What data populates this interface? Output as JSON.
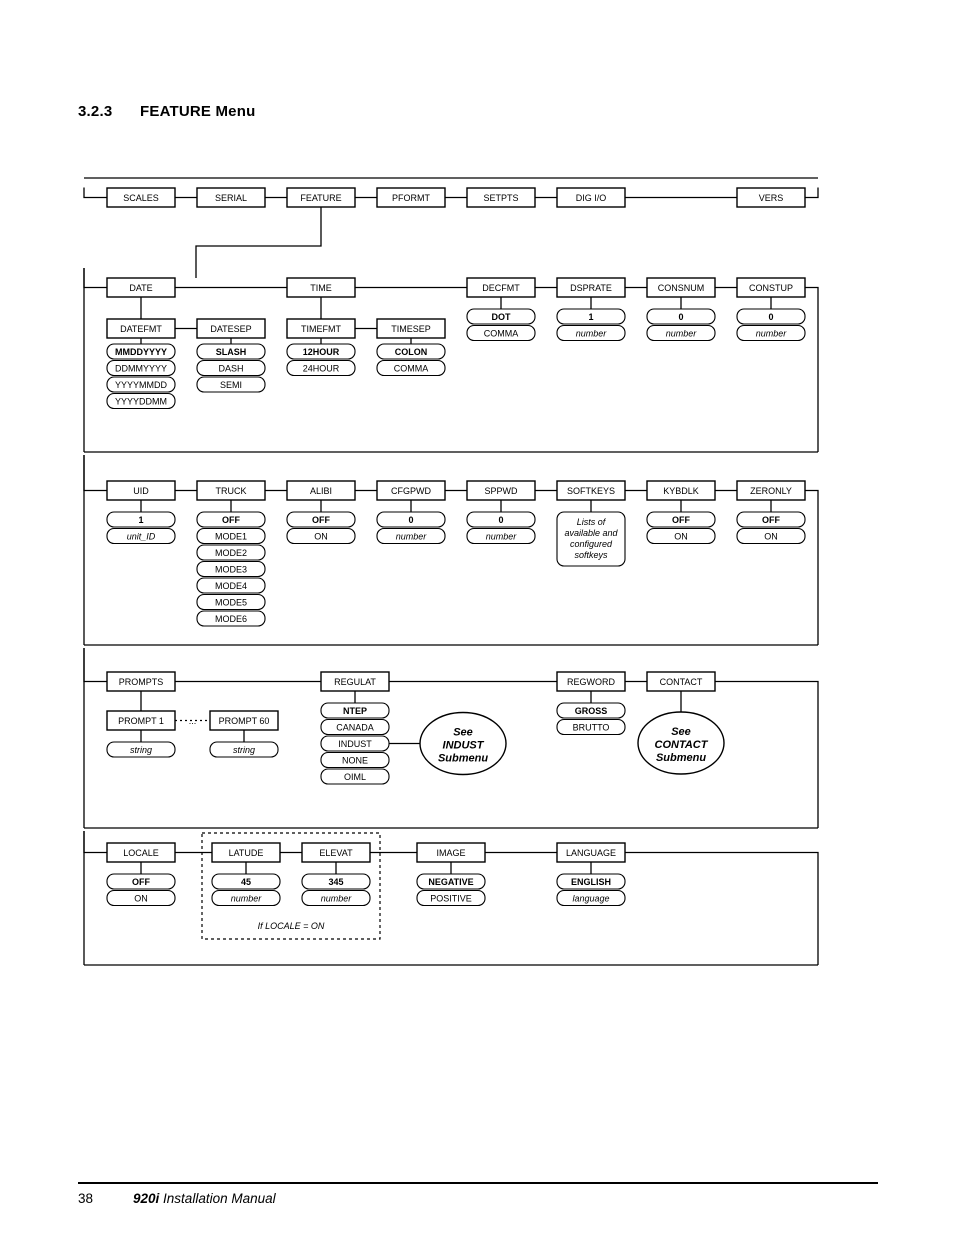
{
  "heading": {
    "number": "3.2.3",
    "title": "FEATURE Menu"
  },
  "footer": {
    "page_number": "38",
    "model": "920i",
    "title": "Installation Manual"
  },
  "top_menu": {
    "items": [
      {
        "label": "SCALES"
      },
      {
        "label": "SERIAL"
      },
      {
        "label": "FEATURE"
      },
      {
        "label": "PFORMT"
      },
      {
        "label": "SETPTS"
      },
      {
        "label": "DIG I/O"
      },
      {
        "label": "VERS"
      }
    ],
    "expanded": "FEATURE"
  },
  "rows": [
    {
      "id": "row-1",
      "nodes": [
        {
          "label": "DATE",
          "children": [
            {
              "label": "DATEFMT",
              "values": [
                "MMDDYYYY",
                "DDMMYYYY",
                "YYYYMMDD",
                "YYYYDDMM"
              ],
              "default": "MMDDYYYY"
            },
            {
              "label": "DATESEP",
              "values": [
                "SLASH",
                "DASH",
                "SEMI"
              ],
              "default": "SLASH"
            }
          ]
        },
        {
          "label": "TIME",
          "children": [
            {
              "label": "TIMEFMT",
              "values": [
                "12HOUR",
                "24HOUR"
              ],
              "default": "12HOUR"
            },
            {
              "label": "TIMESEP",
              "values": [
                "COLON",
                "COMMA"
              ],
              "default": "COLON"
            }
          ]
        },
        {
          "label": "DECFMT",
          "values": [
            "DOT",
            "COMMA"
          ],
          "default": "DOT"
        },
        {
          "label": "DSPRATE",
          "values": [
            "1",
            "number"
          ],
          "default": "1",
          "italic": [
            "number"
          ]
        },
        {
          "label": "CONSNUM",
          "values": [
            "0",
            "number"
          ],
          "default": "0",
          "italic": [
            "number"
          ]
        },
        {
          "label": "CONSTUP",
          "values": [
            "0",
            "number"
          ],
          "default": "0",
          "italic": [
            "number"
          ]
        }
      ]
    },
    {
      "id": "row-2",
      "nodes": [
        {
          "label": "UID",
          "values": [
            "1",
            "unit_ID"
          ],
          "default": "1",
          "italic": [
            "unit_ID"
          ]
        },
        {
          "label": "TRUCK",
          "values": [
            "OFF",
            "MODE1",
            "MODE2",
            "MODE3",
            "MODE4",
            "MODE5",
            "MODE6"
          ],
          "default": "OFF"
        },
        {
          "label": "ALIBI",
          "values": [
            "OFF",
            "ON"
          ],
          "default": "OFF"
        },
        {
          "label": "CFGPWD",
          "values": [
            "0",
            "number"
          ],
          "default": "0",
          "italic": [
            "number"
          ]
        },
        {
          "label": "SPPWD",
          "values": [
            "0",
            "number"
          ],
          "default": "0",
          "italic": [
            "number"
          ]
        },
        {
          "label": "SOFTKEYS",
          "multiline_value": [
            "Lists of",
            "available and",
            "configured",
            "softkeys"
          ]
        },
        {
          "label": "KYBDLK",
          "values": [
            "OFF",
            "ON"
          ],
          "default": "OFF"
        },
        {
          "label": "ZERONLY",
          "values": [
            "OFF",
            "ON"
          ],
          "default": "OFF"
        }
      ]
    },
    {
      "id": "row-3",
      "nodes": [
        {
          "label": "PROMPTS",
          "prompt_chain": {
            "first": {
              "label": "PROMPT 1",
              "value": "string"
            },
            "last": {
              "label": "PROMPT 60",
              "value": "string"
            },
            "separator": "..."
          }
        },
        {
          "label": "REGULAT",
          "values": [
            "NTEP",
            "CANADA",
            "INDUST",
            "NONE",
            "OIML"
          ],
          "default": "NTEP",
          "submenu_from": "INDUST",
          "submenu_label": [
            "See",
            "INDUST",
            "Submenu"
          ]
        },
        {
          "label": "REGWORD",
          "values": [
            "GROSS",
            "BRUTTO"
          ],
          "default": "GROSS"
        },
        {
          "label": "CONTACT",
          "submenu_label": [
            "See",
            "CONTACT",
            "Submenu"
          ]
        }
      ]
    },
    {
      "id": "row-4",
      "nodes": [
        {
          "label": "LOCALE",
          "values": [
            "OFF",
            "ON"
          ],
          "default": "OFF"
        },
        {
          "label": "LATUDE",
          "values": [
            "45",
            "number"
          ],
          "default": "45",
          "italic": [
            "number"
          ],
          "conditional": true
        },
        {
          "label": "ELEVAT",
          "values": [
            "345",
            "number"
          ],
          "default": "345",
          "italic": [
            "number"
          ],
          "conditional": true
        },
        {
          "label": "IMAGE",
          "values": [
            "NEGATIVE",
            "POSITIVE"
          ],
          "default": "NEGATIVE"
        },
        {
          "label": "LANGUAGE",
          "values": [
            "ENGLISH",
            "language"
          ],
          "default": "ENGLISH",
          "italic": [
            "language"
          ]
        }
      ],
      "condition_note": "If LOCALE = ON"
    }
  ]
}
